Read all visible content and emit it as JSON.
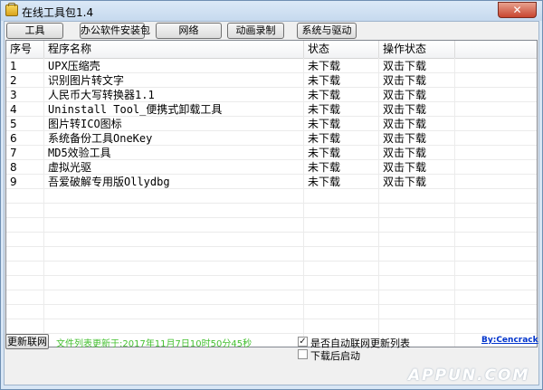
{
  "window": {
    "title": "在线工具包1.4"
  },
  "toolbar": {
    "tabs": [
      "工具",
      "办公软件安装包",
      "网络",
      "动画录制",
      "系统与驱动"
    ]
  },
  "list": {
    "columns": [
      "序号",
      "程序名称",
      "状态",
      "操作状态"
    ],
    "rows": [
      {
        "no": "1",
        "name": "UPX压缩壳",
        "status": "未下载",
        "action": "双击下载"
      },
      {
        "no": "2",
        "name": "识别图片转文字",
        "status": "未下载",
        "action": "双击下载"
      },
      {
        "no": "3",
        "name": "人民币大写转换器1.1",
        "status": "未下载",
        "action": "双击下载"
      },
      {
        "no": "4",
        "name": "Uninstall Tool_便携式卸载工具",
        "status": "未下载",
        "action": "双击下载"
      },
      {
        "no": "5",
        "name": "图片转ICO图标",
        "status": "未下载",
        "action": "双击下载"
      },
      {
        "no": "6",
        "name": "系统备份工具OneKey",
        "status": "未下载",
        "action": "双击下载"
      },
      {
        "no": "7",
        "name": "MD5效验工具",
        "status": "未下载",
        "action": "双击下载"
      },
      {
        "no": "8",
        "name": "虚拟光驱",
        "status": "未下载",
        "action": "双击下载"
      },
      {
        "no": "9",
        "name": "吾爱破解专用版Ollydbg",
        "status": "未下载",
        "action": "双击下载"
      }
    ]
  },
  "footer": {
    "refresh_label": "更新联网",
    "update_text": "文件列表更新于:2017年11月7日10时50分45秒",
    "auto_update_label": "是否自动联网更新列表",
    "auto_update_checked": true,
    "launch_after_label": "下载后启动",
    "launch_after_checked": false,
    "author_link": "By:Cencrack"
  },
  "watermark": "APPUN.COM",
  "colors": {
    "update_text": "#44c030",
    "link": "#0033cc",
    "close_button": "#c8452f"
  }
}
